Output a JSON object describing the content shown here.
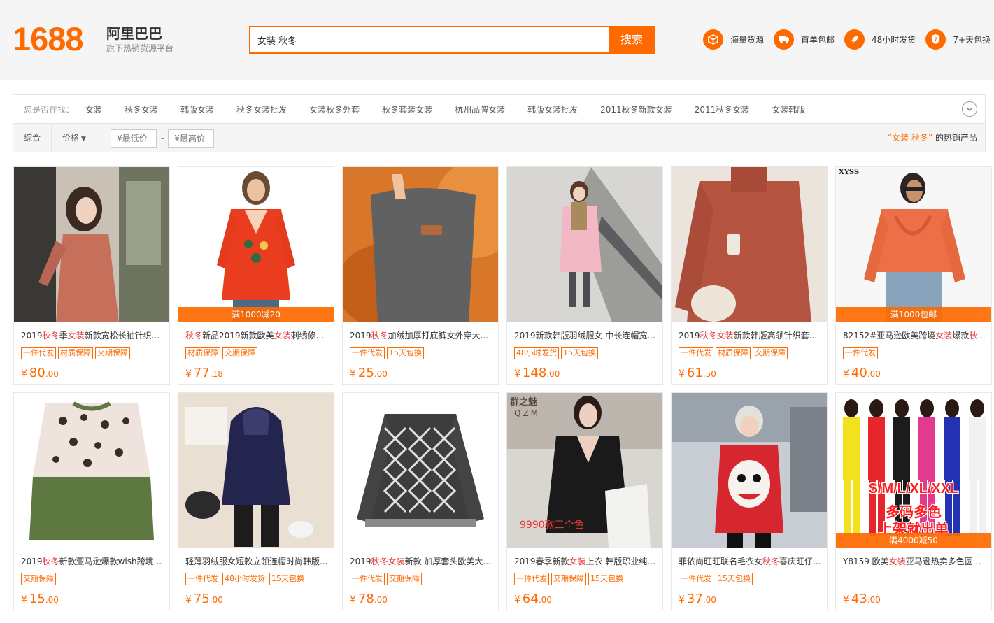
{
  "header": {
    "logo_number": "1688",
    "logo_name": "阿里巴巴",
    "logo_subtitle": "旗下热销货源平台",
    "search_value": "女装 秋冬",
    "search_button": "搜索",
    "features": [
      {
        "icon": "box-icon",
        "label": "海量货源"
      },
      {
        "icon": "truck-icon",
        "label": "首单包邮"
      },
      {
        "icon": "rocket-icon",
        "label": "48小时发货"
      },
      {
        "icon": "seven-days-icon",
        "label": "7+天包换"
      }
    ]
  },
  "suggest": {
    "label": "您是否在找：",
    "items": [
      "女装",
      "秋冬女装",
      "韩版女装",
      "秋冬女装批发",
      "女装秋冬外套",
      "秋冬套装女装",
      "杭州品牌女装",
      "韩版女装批发",
      "2011秋冬新款女装",
      "2011秋冬女装",
      "女装韩版"
    ]
  },
  "sort": {
    "comprehensive": "综合",
    "price": "价格",
    "min_price_placeholder": "¥最低价",
    "max_price_placeholder": "¥最高价",
    "dash": "-",
    "hot_keyword": "“女装 秋冬”",
    "hot_suffix": "的热销产品"
  },
  "products": [
    {
      "title_parts": [
        [
          "2019",
          0
        ],
        [
          "秋冬",
          1
        ],
        [
          "季",
          0
        ],
        [
          "女装",
          1
        ],
        [
          "新款宽松长袖针织...",
          0
        ]
      ],
      "tags": [
        "一件代发",
        "材质保障",
        "交期保障"
      ],
      "price_int": "80",
      "price_dec": ".00",
      "promo": "",
      "img": "woman-rust-dress"
    },
    {
      "title_parts": [
        [
          "秋冬",
          1
        ],
        [
          "新品2019新款欧美",
          0
        ],
        [
          "女装",
          1
        ],
        [
          "刺绣修...",
          0
        ]
      ],
      "tags": [
        "材质保障",
        "交期保障"
      ],
      "price_int": "77",
      "price_dec": ".18",
      "promo": "满1000减20",
      "img": "red-embroidered-top"
    },
    {
      "title_parts": [
        [
          "2019",
          0
        ],
        [
          "秋冬",
          1
        ],
        [
          "加绒加厚打底裤女外穿大...",
          0
        ]
      ],
      "tags": [
        "一件代发",
        "15天包换"
      ],
      "price_int": "25",
      "price_dec": ".00",
      "promo": "",
      "img": "grey-leggings"
    },
    {
      "title_parts": [
        [
          "2019新款韩版羽绒服女 中长连帽宽...",
          0
        ]
      ],
      "tags": [
        "48小时发货",
        "15天包换"
      ],
      "price_int": "148",
      "price_dec": ".00",
      "promo": "",
      "img": "pink-down-coat"
    },
    {
      "title_parts": [
        [
          "2019",
          0
        ],
        [
          "秋冬",
          1
        ],
        [
          "女装",
          1
        ],
        [
          "新款韩版高领针织套...",
          0
        ]
      ],
      "tags": [
        "一件代发",
        "材质保障",
        "交期保障"
      ],
      "price_int": "61",
      "price_dec": ".50",
      "promo": "",
      "img": "rust-sweater"
    },
    {
      "title_parts": [
        [
          "82152#亚马逊欧美跨境",
          0
        ],
        [
          "女装",
          1
        ],
        [
          "爆款",
          0
        ],
        [
          "秋...",
          1
        ]
      ],
      "tags": [
        "一件代发"
      ],
      "price_int": "40",
      "price_dec": ".00",
      "promo": "满1000包邮",
      "img": "orange-knit-sweater",
      "brand_mark": "XYSS"
    },
    {
      "title_parts": [
        [
          "2019",
          0
        ],
        [
          "秋冬",
          1
        ],
        [
          "新款亚马逊爆款wish跨境...",
          0
        ]
      ],
      "tags": [
        "交期保障"
      ],
      "price_int": "15",
      "price_dec": ".00",
      "promo": "",
      "img": "leopard-sweatshirt"
    },
    {
      "title_parts": [
        [
          "轻薄羽绒服女短款立领连帽时尚韩版...",
          0
        ]
      ],
      "tags": [
        "一件代发",
        "48小时发货",
        "15天包换"
      ],
      "price_int": "75",
      "price_dec": ".00",
      "promo": "",
      "img": "navy-puffer-jacket"
    },
    {
      "title_parts": [
        [
          "2019",
          0
        ],
        [
          "秋冬",
          1
        ],
        [
          "女装",
          1
        ],
        [
          "新款 加厚套头欧美大...",
          0
        ]
      ],
      "tags": [
        "一件代发",
        "交期保障"
      ],
      "price_int": "78",
      "price_dec": ".00",
      "promo": "",
      "img": "black-white-knit"
    },
    {
      "title_parts": [
        [
          "2019春季新款",
          0
        ],
        [
          "女装",
          1
        ],
        [
          "上衣 韩版职业纯...",
          0
        ]
      ],
      "tags": [
        "一件代发",
        "交期保障",
        "15天包换"
      ],
      "price_int": "64",
      "price_dec": ".00",
      "promo": "",
      "img": "black-satin-blouse",
      "brand_mark": "群之魅",
      "brand_sub": "QZM",
      "overlay_text": "9990款三个色"
    },
    {
      "title_parts": [
        [
          "菲侬尚旺旺联名毛衣女",
          0
        ],
        [
          "秋冬",
          1
        ],
        [
          "喜庆旺仔...",
          0
        ]
      ],
      "tags": [
        "一件代发",
        "15天包换"
      ],
      "price_int": "37",
      "price_dec": ".00",
      "promo": "",
      "img": "red-wangzai-sweater"
    },
    {
      "title_parts": [
        [
          "Y8159 欧美",
          0
        ],
        [
          "女装",
          1
        ],
        [
          "亚马逊热卖多色圆...",
          0
        ]
      ],
      "tags": [],
      "price_int": "43",
      "price_dec": ".00",
      "promo": "满4000减50",
      "img": "multicolor-tracksuits",
      "overlay_line1": "S/M/L/XL/XXL",
      "overlay_line2": "多码多色",
      "overlay_line3": "上架就出单"
    }
  ],
  "currency": "¥",
  "colors": {
    "accent": "#ff6a00",
    "keyword": "#e4393c"
  }
}
